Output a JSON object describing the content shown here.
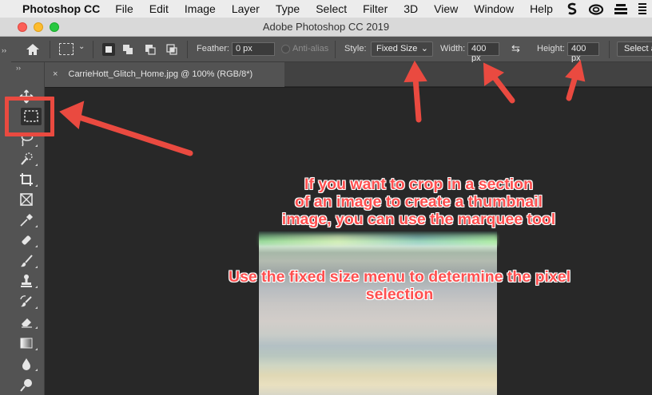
{
  "menubar": {
    "app_name": "Photoshop CC",
    "items": [
      "File",
      "Edit",
      "Image",
      "Layer",
      "Type",
      "Select",
      "Filter",
      "3D",
      "View",
      "Window",
      "Help"
    ]
  },
  "window": {
    "title": "Adobe Photoshop CC 2019"
  },
  "options": {
    "feather_label": "Feather:",
    "feather_value": "0 px",
    "antialias_label": "Anti-alias",
    "style_label": "Style:",
    "style_value": "Fixed Size",
    "width_label": "Width:",
    "width_value": "400 px",
    "height_label": "Height:",
    "height_value": "400 px",
    "select_button": "Select a"
  },
  "tab": {
    "title": "CarrieHott_Glitch_Home.jpg @ 100% (RGB/8*)",
    "close": "×"
  },
  "edge_glyph": "››",
  "toolbar_grip": "››",
  "annotations": {
    "note1_line1": "If you want to crop in a section",
    "note1_line2": "of an image to create a thumbnail",
    "note1_line3": "image, you can use the marquee tool",
    "note2_line1": "Use the fixed size menu to determine the pixel",
    "note2_line2": "selection"
  },
  "colors": {
    "annotation_red": "#ea4a40",
    "panel_gray": "#535353",
    "canvas_dark": "#282828"
  },
  "icons": {
    "tools": [
      "move-icon",
      "rect-marquee-icon",
      "lasso-icon",
      "quick-select-icon",
      "crop-icon",
      "frame-icon",
      "eyedropper-icon",
      "healing-brush-icon",
      "brush-icon",
      "clone-stamp-icon",
      "history-brush-icon",
      "eraser-icon",
      "gradient-icon",
      "blur-icon",
      "dodge-icon"
    ]
  }
}
